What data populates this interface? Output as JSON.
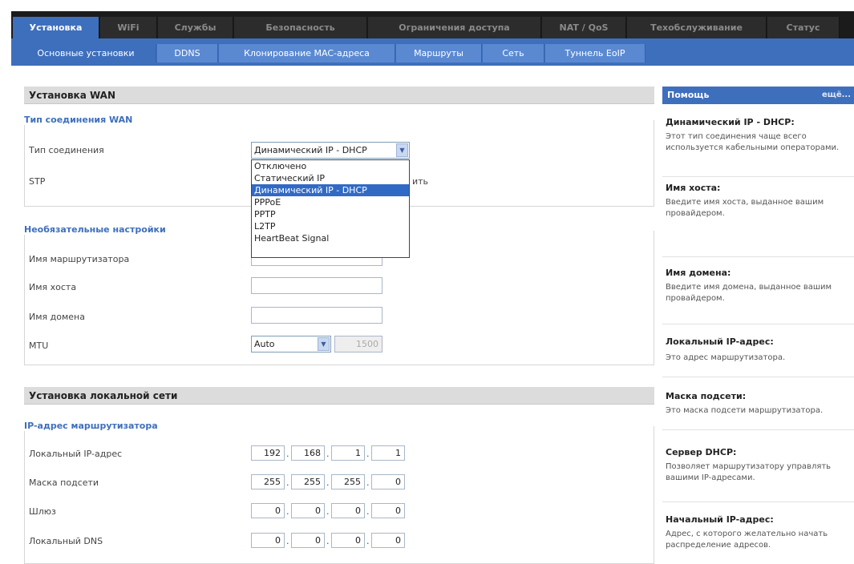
{
  "top_nav": {
    "tabs": [
      {
        "label": "Установка",
        "active": true
      },
      {
        "label": "WiFi",
        "active": false
      },
      {
        "label": "Службы",
        "active": false
      },
      {
        "label": "Безопасность",
        "active": false
      },
      {
        "label": "Ограничения доступа",
        "active": false
      },
      {
        "label": "NAT / QoS",
        "active": false
      },
      {
        "label": "Техобслуживание",
        "active": false
      },
      {
        "label": "Статус",
        "active": false
      }
    ]
  },
  "sub_nav": {
    "tabs": [
      {
        "label": "Основные установки",
        "active": true
      },
      {
        "label": "DDNS",
        "active": false
      },
      {
        "label": "Клонирование MAC-адреса",
        "active": false
      },
      {
        "label": "Маршруты",
        "active": false
      },
      {
        "label": "Сеть",
        "active": false
      },
      {
        "label": "Туннель EoIP",
        "active": false
      }
    ]
  },
  "wan": {
    "section_title": "Установка WAN",
    "legend": "Тип соединения WAN",
    "connection_type_label": "Тип соединения",
    "connection_type_value": "Динамический IP - DHCP",
    "stp_label": "STP",
    "stp_partial": "ить",
    "dropdown_options": [
      "Отключено",
      "Статический IP",
      "Динамический IP - DHCP",
      "PPPoE",
      "PPTP",
      "L2TP",
      "HeartBeat Signal"
    ],
    "dropdown_selected_index": 2
  },
  "optional": {
    "legend": "Необязательные настройки",
    "router_name_label": "Имя маршрутизатора",
    "hostname_label": "Имя хоста",
    "domain_label": "Имя домена",
    "mtu_label": "MTU",
    "mtu_value": "Auto",
    "mtu_number": "1500"
  },
  "lan": {
    "section_title": "Установка локальной сети",
    "legend": "IP-адрес маршрутизатора",
    "rows": [
      {
        "label": "Локальный IP-адрес",
        "octets": [
          "192",
          "168",
          "1",
          "1"
        ]
      },
      {
        "label": "Маска подсети",
        "octets": [
          "255",
          "255",
          "255",
          "0"
        ]
      },
      {
        "label": "Шлюз",
        "octets": [
          "0",
          "0",
          "0",
          "0"
        ]
      },
      {
        "label": "Локальный DNS",
        "octets": [
          "0",
          "0",
          "0",
          "0"
        ]
      }
    ]
  },
  "help": {
    "header": "Помощь",
    "more": "ещё...",
    "items": [
      {
        "title": "Динамический IP - DHCP:",
        "text": "Этот тип соединения чаще всего используется кабельными операторами."
      },
      {
        "title": "Имя хоста:",
        "text": "Введите имя хоста, выданное вашим провайдером."
      },
      {
        "title": "Имя домена:",
        "text": "Введите имя домена, выданное вашим провайдером."
      },
      {
        "title": "Локальный IP-адрес:",
        "text": "Это адрес маршрутизатора."
      },
      {
        "title": "Маска подсети:",
        "text": "Это маска подсети маршрутизатора."
      },
      {
        "title": "Сервер DHCP:",
        "text": "Позволяет маршрутизатору управлять вашими IP-адресами."
      },
      {
        "title": "Начальный IP-адрес:",
        "text": "Адрес, с которого желательно начать распределение адресов."
      }
    ]
  }
}
